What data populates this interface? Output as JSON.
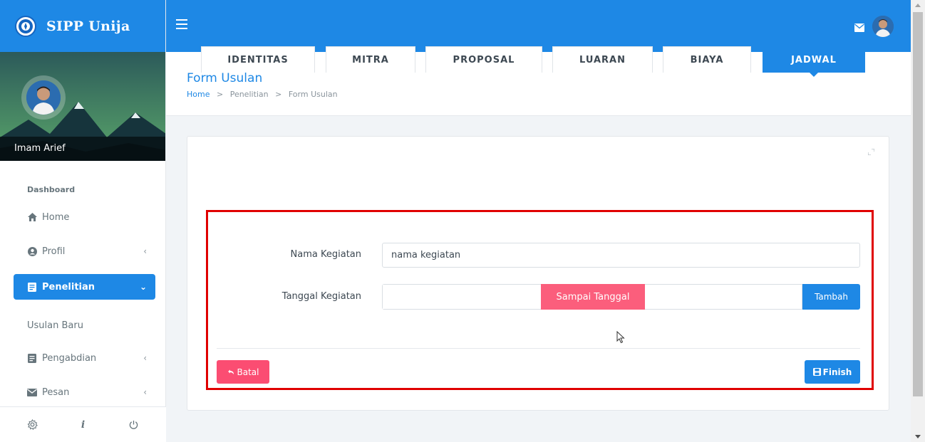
{
  "app": {
    "brand_title": "SIPP Unija",
    "accent_color": "#1e88e5",
    "danger_color": "#fb4d72"
  },
  "sidebar": {
    "user_name": "Imam Arief",
    "section_label": "Dashboard",
    "items": [
      {
        "label": "Home",
        "icon": "home-icon",
        "chevron": ""
      },
      {
        "label": "Profil",
        "icon": "user-circle-icon",
        "chevron": "‹"
      },
      {
        "label": "Penelitian",
        "icon": "document-icon",
        "chevron": "⌄",
        "active": true
      },
      {
        "label": "Usulan Baru",
        "icon": "",
        "chevron": ""
      },
      {
        "label": "Pengabdian",
        "icon": "document-icon",
        "chevron": "‹"
      },
      {
        "label": "Pesan",
        "icon": "mail-icon",
        "chevron": "‹"
      }
    ],
    "footer": {
      "settings": "gear-icon",
      "info": "i",
      "power": "power-icon"
    }
  },
  "header": {
    "page_title": "Form Usulan",
    "breadcrumb": {
      "home": "Home",
      "section": "Penelitian",
      "current": "Form Usulan",
      "separator": ">"
    }
  },
  "tabs": [
    {
      "label": "IDENTITAS"
    },
    {
      "label": "MITRA"
    },
    {
      "label": "PROPOSAL"
    },
    {
      "label": "LUARAN"
    },
    {
      "label": "BIAYA"
    },
    {
      "label": "JADWAL",
      "active": true
    }
  ],
  "form": {
    "nama_kegiatan_label": "Nama Kegiatan",
    "nama_kegiatan_value": "nama kegiatan",
    "tanggal_kegiatan_label": "Tanggal Kegiatan",
    "tanggal_start_value": "",
    "sampai_label": "Sampai Tanggal",
    "tanggal_end_value": "",
    "tambah_label": "Tambah"
  },
  "actions": {
    "batal_label": "Batal",
    "finish_label": "Finish"
  }
}
